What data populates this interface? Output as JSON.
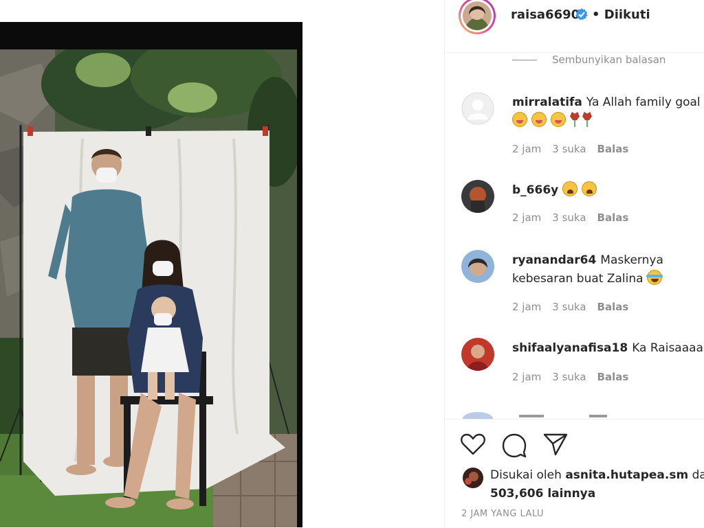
{
  "post": {
    "username": "raisa6690",
    "follow_status": "• Diikuti",
    "hide_replies_label": "Sembunyikan balasan"
  },
  "comments": [
    {
      "username": "mirralatifa",
      "text": "Ya Allah family goal",
      "emoji_line": [
        "drool",
        "drool",
        "drool",
        "rose",
        "rose"
      ],
      "time": "2 jam",
      "likes": "3 suka",
      "reply": "Balas"
    },
    {
      "username": "b_666y",
      "text": "",
      "emoji_inline": [
        "weary",
        "weary"
      ],
      "time": "2 jam",
      "likes": "3 suka",
      "reply": "Balas"
    },
    {
      "username": "ryanandar64",
      "text": "Maskernya",
      "text_line2": "kebesaran buat Zalina",
      "emoji_line2": [
        "laugh"
      ],
      "time": "2 jam",
      "likes": "3 suka",
      "reply": "Balas"
    },
    {
      "username": "shifaalyanafisa18",
      "text": "Ka Raisaaaa",
      "trailing_icon": "black-heart-icon",
      "time": "2 jam",
      "likes": "3 suka",
      "reply": "Balas"
    }
  ],
  "actions": {
    "icons": [
      "heart-icon",
      "comment-icon",
      "share-icon"
    ]
  },
  "likes": {
    "prefix": "Disukai oleh",
    "user": "asnita.hutapea.sm",
    "suffix": "da",
    "count": "503,606 lainnya"
  },
  "timestamp": "2 JAM YANG LALU"
}
